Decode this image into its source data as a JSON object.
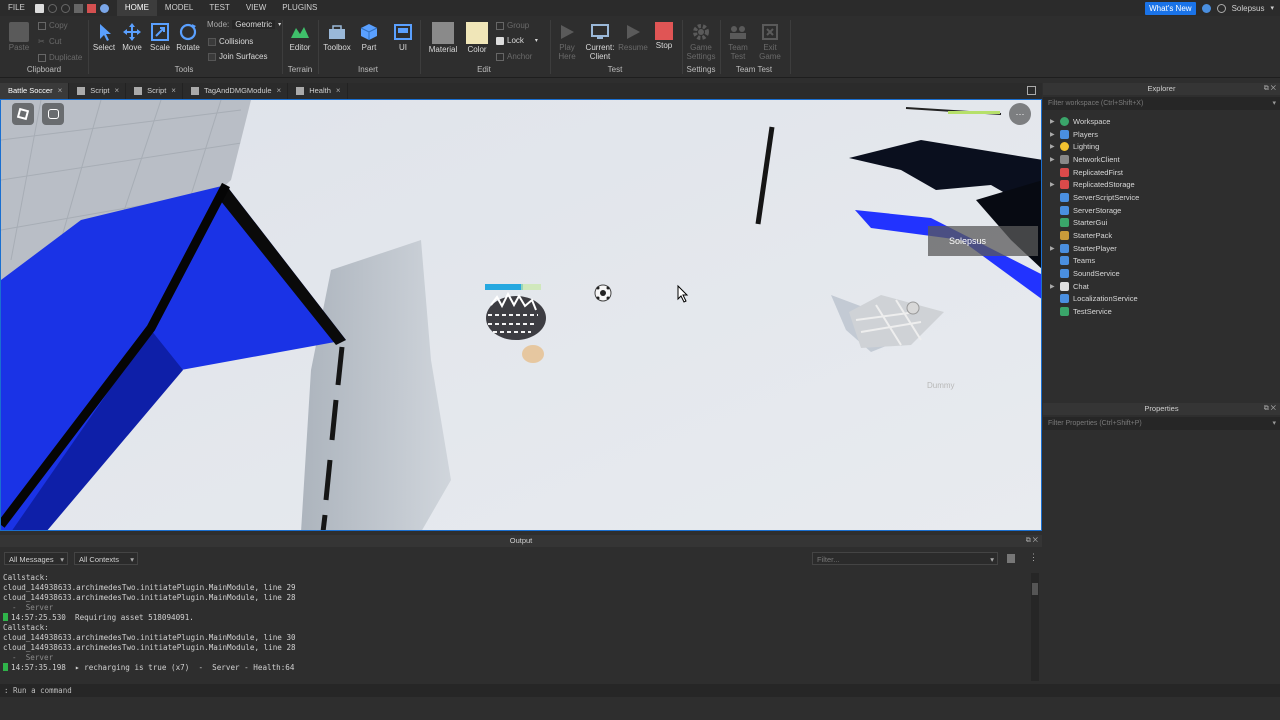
{
  "menu": {
    "file": "FILE",
    "tabs": [
      "HOME",
      "MODEL",
      "TEST",
      "VIEW",
      "PLUGINS"
    ],
    "active_tab": "HOME",
    "whats_new": "What's New",
    "user": "Solepsus"
  },
  "ribbon": {
    "clipboard": {
      "label": "Clipboard",
      "paste": "Paste",
      "copy": "Copy",
      "cut": "Cut",
      "duplicate": "Duplicate"
    },
    "tools": {
      "label": "Tools",
      "select": "Select",
      "move": "Move",
      "scale": "Scale",
      "rotate": "Rotate",
      "mode_label": "Mode:",
      "mode_value": "Geometric",
      "collisions": "Collisions",
      "join_surfaces": "Join Surfaces"
    },
    "terrain": {
      "label": "Terrain",
      "editor": "Editor"
    },
    "insert": {
      "label": "Insert",
      "toolbox": "Toolbox",
      "part": "Part",
      "ui": "UI"
    },
    "edit": {
      "label": "Edit",
      "material": "Material",
      "color": "Color",
      "group": "Group",
      "lock": "Lock",
      "anchor": "Anchor"
    },
    "test": {
      "label": "Test",
      "play_here": "Play Here",
      "current_client": "Current: Client",
      "resume": "Resume",
      "stop": "Stop"
    },
    "settings": {
      "label": "Settings",
      "game_settings": "Game Settings"
    },
    "team_test": {
      "label": "Team Test",
      "team_test": "Team Test",
      "exit_game": "Exit Game"
    }
  },
  "doc_tabs": [
    {
      "label": "Battle Soccer",
      "active": true
    },
    {
      "label": "Script",
      "active": false
    },
    {
      "label": "Script",
      "active": false
    },
    {
      "label": "TagAndDMGModule",
      "active": false
    },
    {
      "label": "Health",
      "active": false
    }
  ],
  "viewport": {
    "player_name": "Solepsus",
    "npc_label": "Dummy"
  },
  "explorer": {
    "title": "Explorer",
    "filter_placeholder": "Filter workspace (Ctrl+Shift+X)",
    "items": [
      {
        "label": "Workspace",
        "icon": "globe-icon",
        "color": "#3aa56a",
        "expandable": true
      },
      {
        "label": "Players",
        "icon": "players-icon",
        "color": "#4a8fe0",
        "expandable": true
      },
      {
        "label": "Lighting",
        "icon": "lightbulb-icon",
        "color": "#f2c230",
        "expandable": true
      },
      {
        "label": "NetworkClient",
        "icon": "network-icon",
        "color": "#888888",
        "expandable": true
      },
      {
        "label": "ReplicatedFirst",
        "icon": "replicated-icon",
        "color": "#d94a4a",
        "expandable": false
      },
      {
        "label": "ReplicatedStorage",
        "icon": "replicated-icon",
        "color": "#d94a4a",
        "expandable": true
      },
      {
        "label": "ServerScriptService",
        "icon": "server-script-icon",
        "color": "#4a8fe0",
        "expandable": false
      },
      {
        "label": "ServerStorage",
        "icon": "server-storage-icon",
        "color": "#4a8fe0",
        "expandable": false
      },
      {
        "label": "StarterGui",
        "icon": "gui-icon",
        "color": "#3aa56a",
        "expandable": false
      },
      {
        "label": "StarterPack",
        "icon": "pack-icon",
        "color": "#c99b3a",
        "expandable": false
      },
      {
        "label": "StarterPlayer",
        "icon": "player-icon",
        "color": "#4a8fe0",
        "expandable": true
      },
      {
        "label": "Teams",
        "icon": "teams-icon",
        "color": "#4a8fe0",
        "expandable": false
      },
      {
        "label": "SoundService",
        "icon": "sound-icon",
        "color": "#4a8fe0",
        "expandable": false
      },
      {
        "label": "Chat",
        "icon": "chat-icon",
        "color": "#e0e0e0",
        "expandable": true
      },
      {
        "label": "LocalizationService",
        "icon": "localization-icon",
        "color": "#4a8fe0",
        "expandable": false
      },
      {
        "label": "TestService",
        "icon": "test-icon",
        "color": "#3aa56a",
        "expandable": false
      }
    ]
  },
  "properties": {
    "title": "Properties",
    "filter_placeholder": "Filter Properties (Ctrl+Shift+P)"
  },
  "output": {
    "title": "Output",
    "messages_filter": "All Messages",
    "contexts_filter": "All Contexts",
    "search_placeholder": "Filter...",
    "lines": [
      {
        "kind": "text",
        "text": "Callstack:"
      },
      {
        "kind": "text",
        "text": "cloud_144938633.archimedesTwo.initiatePlugin.MainModule, line 29"
      },
      {
        "kind": "text",
        "text": "cloud_144938633.archimedesTwo.initiatePlugin.MainModule, line 28"
      },
      {
        "kind": "src",
        "text": "-  Server"
      },
      {
        "kind": "ts",
        "text": "14:57:25.530  Requiring asset 518094091."
      },
      {
        "kind": "text",
        "text": "Callstack:"
      },
      {
        "kind": "text",
        "text": "cloud_144938633.archimedesTwo.initiatePlugin.MainModule, line 30"
      },
      {
        "kind": "text",
        "text": "cloud_144938633.archimedesTwo.initiatePlugin.MainModule, line 28"
      },
      {
        "kind": "src",
        "text": "-  Server"
      },
      {
        "kind": "ts",
        "text": "14:57:35.198  ▸ recharging is true (x7)  -  Server - Health:64"
      }
    ]
  },
  "command_bar": {
    "placeholder": "Run a command"
  }
}
